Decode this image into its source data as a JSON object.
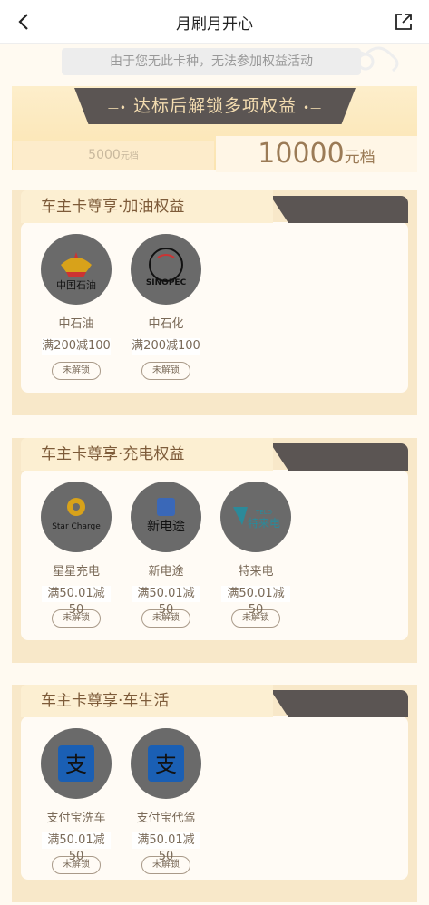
{
  "nav": {
    "title": "月刷月开心",
    "back_icon": "chevron-left-icon",
    "share_icon": "share-icon"
  },
  "notice": "由于您无此卡种，无法参加权益活动",
  "hero": {
    "ribbon_text": "达标后解锁多项权益",
    "tier_left": {
      "amount": "5000",
      "unit": "元档"
    },
    "tier_right": {
      "amount": "10000",
      "unit": "元档"
    }
  },
  "sections": [
    {
      "title": "车主卡尊享·加油权益",
      "items": [
        {
          "name": "中石油",
          "offer": "满200减100",
          "lock": "未解锁",
          "logo": "中国石油"
        },
        {
          "name": "中石化",
          "offer": "满200减100",
          "lock": "未解锁",
          "logo": "SINOPEC"
        }
      ]
    },
    {
      "title": "车主卡尊享·充电权益",
      "items": [
        {
          "name": "星星充电",
          "offer": "满50.01减50",
          "lock": "未解锁",
          "logo": "Star Charge"
        },
        {
          "name": "新电途",
          "offer": "满50.01减50",
          "lock": "未解锁",
          "logo": "新电途"
        },
        {
          "name": "特来电",
          "offer": "满50.01减50",
          "lock": "未解锁",
          "logo": "特来电"
        }
      ]
    },
    {
      "title": "车主卡尊享·车生活",
      "items": [
        {
          "name": "支付宝洗车",
          "offer": "满50.01减50",
          "lock": "未解锁",
          "logo": "支"
        },
        {
          "name": "支付宝代驾",
          "offer": "满50.01减50",
          "lock": "未解锁",
          "logo": "支"
        }
      ]
    }
  ],
  "colors": {
    "page_bg": "#fffaf1",
    "ribbon": "#5b5553",
    "accent_text": "#9b7b56",
    "section_bg": "#f8e8c9",
    "logo_disabled": "#6a6a6a"
  }
}
